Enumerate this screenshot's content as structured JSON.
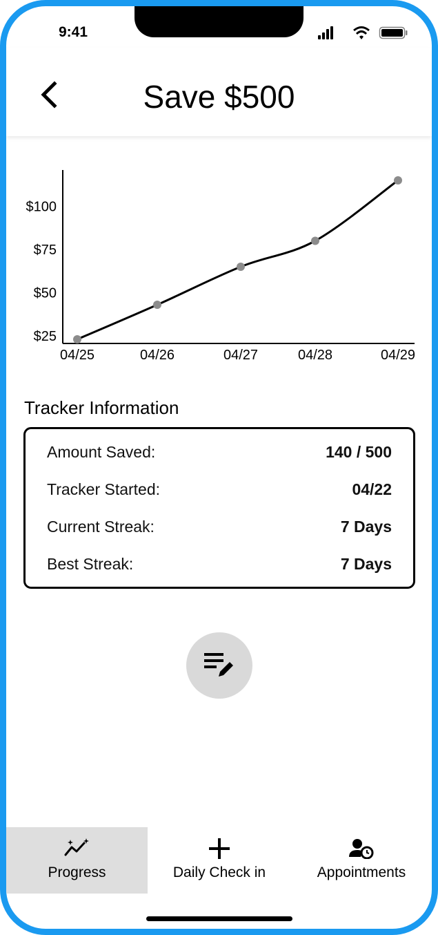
{
  "status_bar": {
    "time": "9:41"
  },
  "header": {
    "title": "Save $500"
  },
  "chart_data": {
    "type": "line",
    "categories": [
      "04/25",
      "04/26",
      "04/27",
      "04/28",
      "04/29"
    ],
    "series": [
      {
        "values": [
          23,
          43,
          65,
          80,
          115
        ]
      }
    ],
    "y_ticks": [
      "$25",
      "$50",
      "$75",
      "$100"
    ],
    "y_tick_values": [
      25,
      50,
      75,
      100
    ],
    "ylim": [
      20,
      120
    ],
    "title": "",
    "xlabel": "",
    "ylabel": "",
    "line_color": "#000000",
    "point_color": "#8c8c8c"
  },
  "tracker": {
    "section_title": "Tracker Information",
    "rows": [
      {
        "label": "Amount Saved:",
        "value": "140 / 500"
      },
      {
        "label": "Tracker Started:",
        "value": "04/22"
      },
      {
        "label": "Current Streak:",
        "value": "7 Days"
      },
      {
        "label": "Best Streak:",
        "value": "7 Days"
      }
    ]
  },
  "fab": {
    "icon": "edit-notes-icon"
  },
  "tabs": [
    {
      "label": "Progress",
      "icon": "progress-chart-icon",
      "active": true
    },
    {
      "label": "Daily Check in",
      "icon": "plus-icon",
      "active": false
    },
    {
      "label": "Appointments",
      "icon": "person-clock-icon",
      "active": false
    }
  ],
  "colors": {
    "frame": "#1a9af0",
    "active_tab_bg": "#dedede",
    "fab_bg": "#d9d9d9"
  }
}
